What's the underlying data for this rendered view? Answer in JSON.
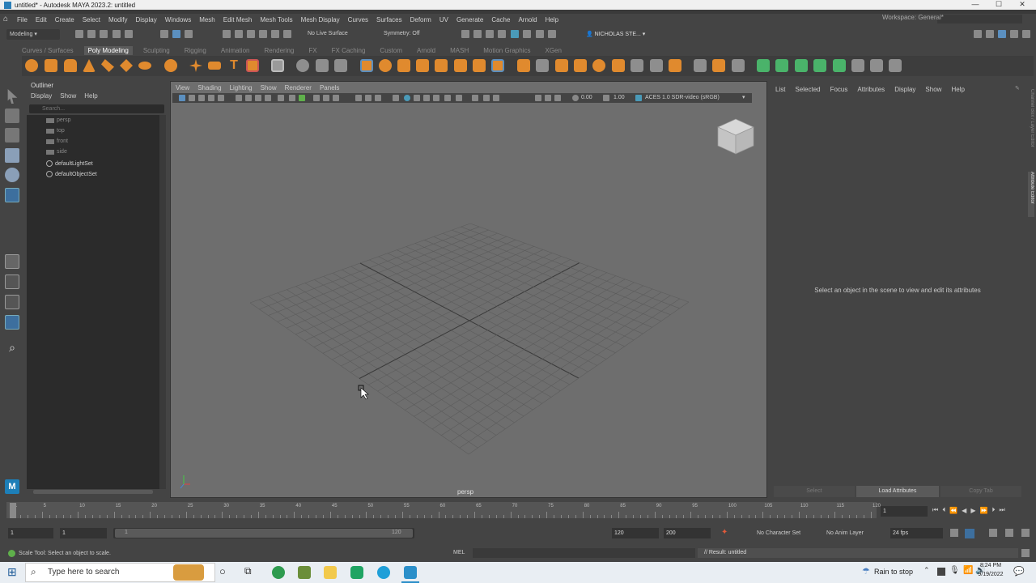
{
  "window": {
    "title": "untitled* - Autodesk MAYA 2023.2: untitled",
    "controls": [
      "—",
      "☐",
      "✕"
    ]
  },
  "menubar": {
    "items": [
      "File",
      "Edit",
      "Create",
      "Select",
      "Modify",
      "Display",
      "Windows",
      "Mesh",
      "Edit Mesh",
      "Mesh Tools",
      "Mesh Display",
      "Curves",
      "Surfaces",
      "Deform",
      "UV",
      "Generate",
      "Cache",
      "Arnold",
      "Help"
    ],
    "workspace_label": "Workspace: General*"
  },
  "statusline": {
    "menuset": "Modeling",
    "live_surface": "No Live Surface",
    "symmetry": "Symmetry: Off",
    "user": "NICHOLAS STE..."
  },
  "shelf": {
    "tabs": [
      "Curves / Surfaces",
      "Poly Modeling",
      "Sculpting",
      "Rigging",
      "Animation",
      "Rendering",
      "FX",
      "FX Caching",
      "Custom",
      "Arnold",
      "MASH",
      "Motion Graphics",
      "XGen"
    ],
    "active_tab": "Poly Modeling",
    "colors": {
      "poly": "#e08a2e",
      "green": "#4ab36a",
      "grey": "#9a9a9a"
    }
  },
  "outliner": {
    "title": "Outliner",
    "menu": [
      "Display",
      "Show",
      "Help"
    ],
    "search_placeholder": "Search...",
    "items": [
      {
        "label": "persp",
        "icon": "camera-icon",
        "dim": true
      },
      {
        "label": "top",
        "icon": "camera-icon",
        "dim": true
      },
      {
        "label": "front",
        "icon": "camera-icon",
        "dim": true
      },
      {
        "label": "side",
        "icon": "camera-icon",
        "dim": true
      },
      {
        "label": "defaultLightSet",
        "icon": "set-icon",
        "dim": false
      },
      {
        "label": "defaultObjectSet",
        "icon": "set-icon",
        "dim": false
      }
    ]
  },
  "viewport": {
    "menu": [
      "View",
      "Shading",
      "Lighting",
      "Show",
      "Renderer",
      "Panels"
    ],
    "exposure": "0.00",
    "gamma": "1.00",
    "colorspace": "ACES 1.0 SDR-video (sRGB)",
    "camera": "persp"
  },
  "attribute_editor": {
    "menu": [
      "List",
      "Selected",
      "Focus",
      "Attributes",
      "Display",
      "Show",
      "Help"
    ],
    "message": "Select an object in the scene to view and edit its attributes",
    "buttons": [
      "Select",
      "Load Attributes",
      "Copy Tab"
    ],
    "side_tabs": [
      "Channel Box / Layer Editor",
      "Attribute Editor"
    ]
  },
  "timeline": {
    "ticks": [
      "1",
      "5",
      "10",
      "15",
      "20",
      "25",
      "30",
      "35",
      "40",
      "45",
      "50",
      "55",
      "60",
      "65",
      "70",
      "75",
      "80",
      "85",
      "90",
      "95",
      "100",
      "105",
      "110",
      "115",
      "120"
    ],
    "current_frame": "1"
  },
  "range": {
    "start": "1",
    "playback_start": "1",
    "slider_start": "1",
    "slider_end": "120",
    "playback_end": "120",
    "end": "200",
    "character_set": "No Character Set",
    "anim_layer": "No Anim Layer",
    "fps": "24 fps"
  },
  "helpline": {
    "text": "Scale Tool: Select an object to scale.",
    "mel_label": "MEL",
    "result": "// Result: untitled"
  },
  "taskbar": {
    "search_placeholder": "Type here to search",
    "weather": "Rain to stop",
    "time": "8:24 PM",
    "date": "9/19/2022"
  }
}
